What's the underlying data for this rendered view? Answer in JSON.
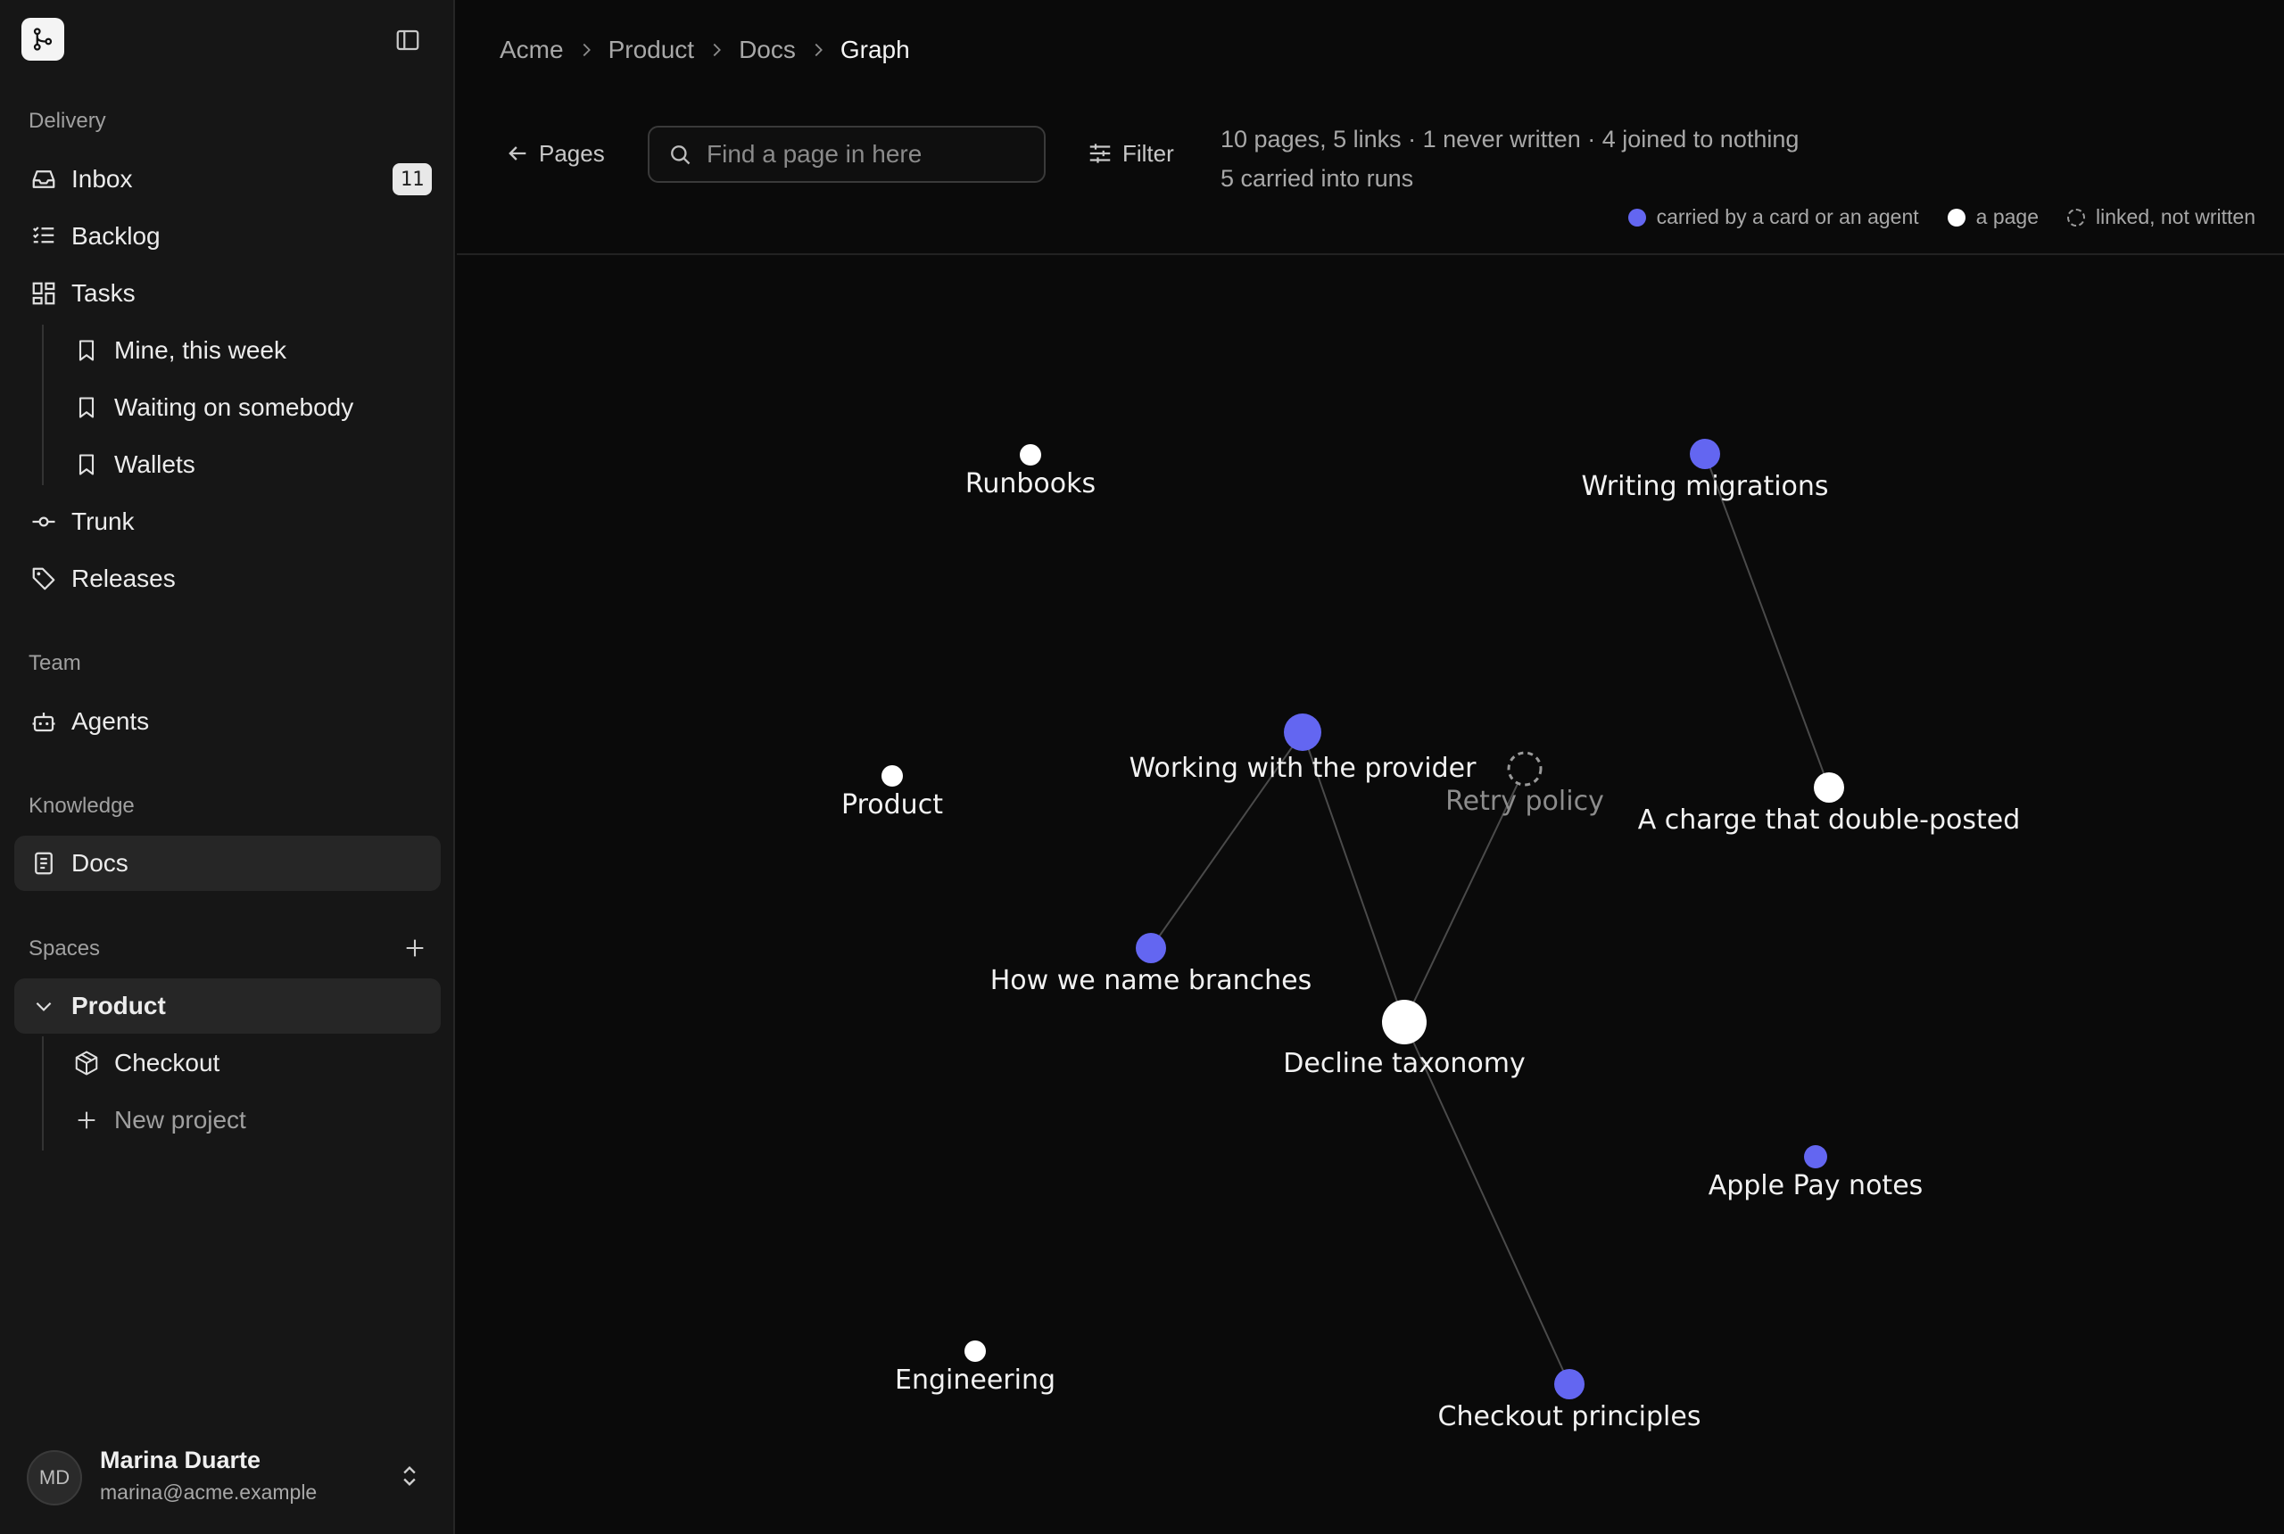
{
  "sidebar": {
    "sections": {
      "delivery": "Delivery",
      "team": "Team",
      "knowledge": "Knowledge",
      "spaces": "Spaces"
    },
    "items": {
      "inbox": {
        "label": "Inbox",
        "badge": "11"
      },
      "backlog": {
        "label": "Backlog"
      },
      "tasks": {
        "label": "Tasks"
      },
      "mine": {
        "label": "Mine, this week"
      },
      "waiting": {
        "label": "Waiting on somebody"
      },
      "wallets": {
        "label": "Wallets"
      },
      "trunk": {
        "label": "Trunk"
      },
      "releases": {
        "label": "Releases"
      },
      "agents": {
        "label": "Agents"
      },
      "docs": {
        "label": "Docs"
      },
      "product": {
        "label": "Product"
      },
      "checkout": {
        "label": "Checkout"
      },
      "new_project": {
        "label": "New project"
      }
    },
    "user": {
      "initials": "MD",
      "name": "Marina Duarte",
      "email": "marina@acme.example"
    }
  },
  "breadcrumb": [
    "Acme",
    "Product",
    "Docs",
    "Graph"
  ],
  "toolbar": {
    "back_label": "Pages",
    "search_placeholder": "Find a page in here",
    "filter_label": "Filter"
  },
  "stats": {
    "line1": "10 pages, 5 links · 1 never written · 4 joined to nothing",
    "line2": "5 carried into runs"
  },
  "legend": [
    {
      "label": "carried by a card or an agent",
      "style": "carried",
      "color": "#6366f1"
    },
    {
      "label": "a page",
      "style": "page",
      "color": "#ffffff"
    },
    {
      "label": "linked, not written",
      "style": "unwritten",
      "color": "#9a9a9a"
    }
  ],
  "graph": {
    "nodes": [
      {
        "id": "runbooks",
        "label": "Runbooks",
        "type": "page"
      },
      {
        "id": "writing-migrations",
        "label": "Writing migrations",
        "type": "carried"
      },
      {
        "id": "product",
        "label": "Product",
        "type": "page"
      },
      {
        "id": "working-provider",
        "label": "Working with the provider",
        "type": "carried"
      },
      {
        "id": "retry-policy",
        "label": "Retry policy",
        "type": "unwritten"
      },
      {
        "id": "charge-double",
        "label": "A charge that double-posted",
        "type": "page"
      },
      {
        "id": "name-branches",
        "label": "How we name branches",
        "type": "carried"
      },
      {
        "id": "decline-taxonomy",
        "label": "Decline taxonomy",
        "type": "page"
      },
      {
        "id": "apple-pay",
        "label": "Apple Pay notes",
        "type": "carried"
      },
      {
        "id": "engineering",
        "label": "Engineering",
        "type": "page"
      },
      {
        "id": "checkout-principles",
        "label": "Checkout principles",
        "type": "carried"
      }
    ],
    "links": [
      [
        "writing-migrations",
        "charge-double"
      ],
      [
        "working-provider",
        "name-branches"
      ],
      [
        "working-provider",
        "decline-taxonomy"
      ],
      [
        "retry-policy",
        "decline-taxonomy"
      ],
      [
        "decline-taxonomy",
        "checkout-principles"
      ]
    ]
  }
}
